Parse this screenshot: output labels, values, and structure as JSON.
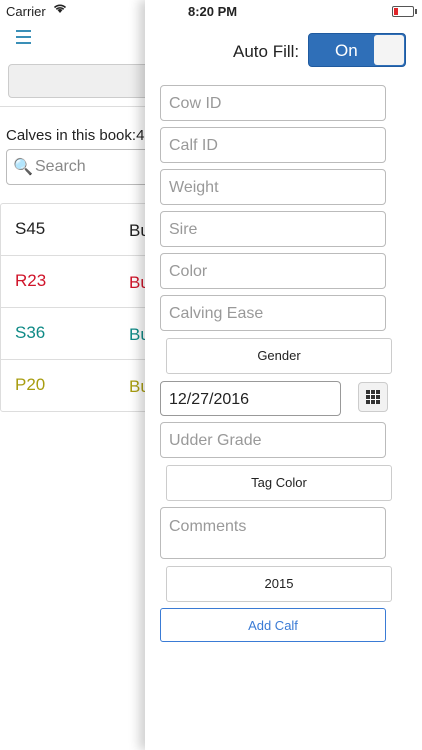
{
  "status_bar": {
    "carrier": "Carrier",
    "time": "8:20 PM"
  },
  "main": {
    "calves_label": "Calves in this book:4",
    "search_placeholder": "Search",
    "rows": [
      {
        "tag": "S45",
        "sex": "Bu",
        "color": "#222222"
      },
      {
        "tag": "R23",
        "sex": "Bu",
        "color": "#d0142a"
      },
      {
        "tag": "S36",
        "sex": "Bu",
        "color": "#0f8a86"
      },
      {
        "tag": "P20",
        "sex": "Bu",
        "color": "#a89d10"
      }
    ]
  },
  "panel": {
    "autofill_label": "Auto Fill:",
    "toggle_label": "On",
    "fields": {
      "cow_id": "Cow ID",
      "calf_id": "Calf ID",
      "weight": "Weight",
      "sire": "Sire",
      "color": "Color",
      "calving_ease": "Calving Ease",
      "udder_grade": "Udder Grade",
      "comments": "Comments"
    },
    "gender_button": "Gender",
    "date_value": "12/27/2016",
    "tag_color_button": "Tag Color",
    "year_button": "2015",
    "add_button": "Add Calf"
  },
  "colors": {
    "accent": "#2f6fb8",
    "link": "#3a7bd5"
  }
}
